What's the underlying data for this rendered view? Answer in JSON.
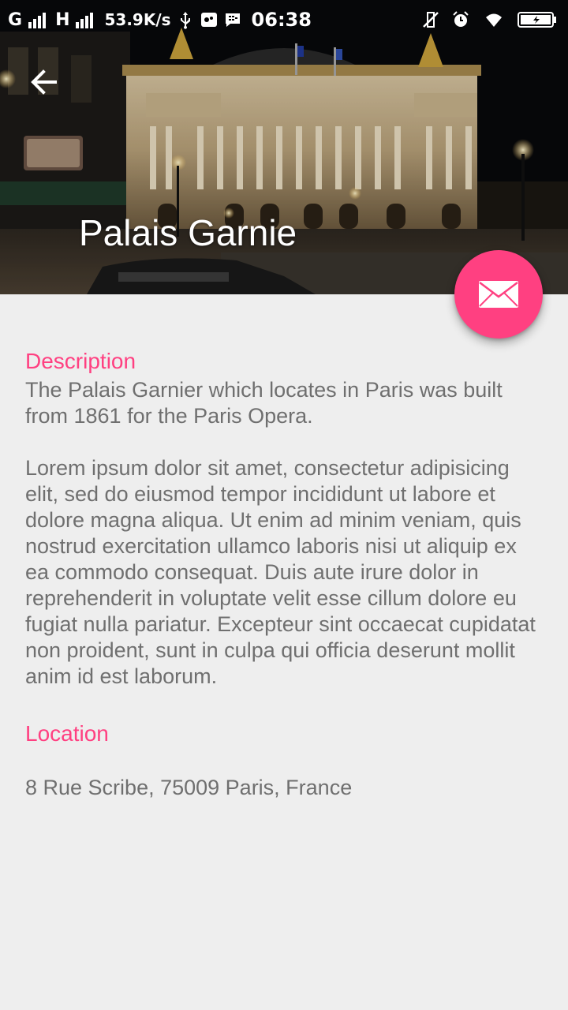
{
  "status_bar": {
    "network_1": "G",
    "network_2": "H",
    "speed": "53.9K/s",
    "time": "06:38"
  },
  "header": {
    "title": "Palais Garnie",
    "back_icon": "arrow-back-icon",
    "image": "palais-garnier-night-photo"
  },
  "fab": {
    "icon": "envelope-icon",
    "color": "#ff4081"
  },
  "description": {
    "title": "Description",
    "paragraph_1": "The Palais Garnier which locates in Paris was built from 1861 for the Paris Opera.",
    "paragraph_2": "Lorem ipsum dolor sit amet, consectetur adipisicing elit, sed do eiusmod tempor incididunt ut labore et dolore magna aliqua. Ut enim ad minim veniam, quis nostrud exercitation ullamco laboris nisi ut aliquip ex ea commodo consequat. Duis aute irure dolor in reprehenderit in voluptate velit esse cillum dolore eu fugiat nulla pariatur. Excepteur sint occaecat cupidatat non proident, sunt in culpa qui officia deserunt mollit anim id est laborum."
  },
  "location": {
    "title": "Location",
    "address": "8 Rue Scribe, 75009 Paris, France"
  },
  "colors": {
    "accent": "#ff4081",
    "background": "#eeeeee",
    "body_text": "#6f6f6f"
  }
}
